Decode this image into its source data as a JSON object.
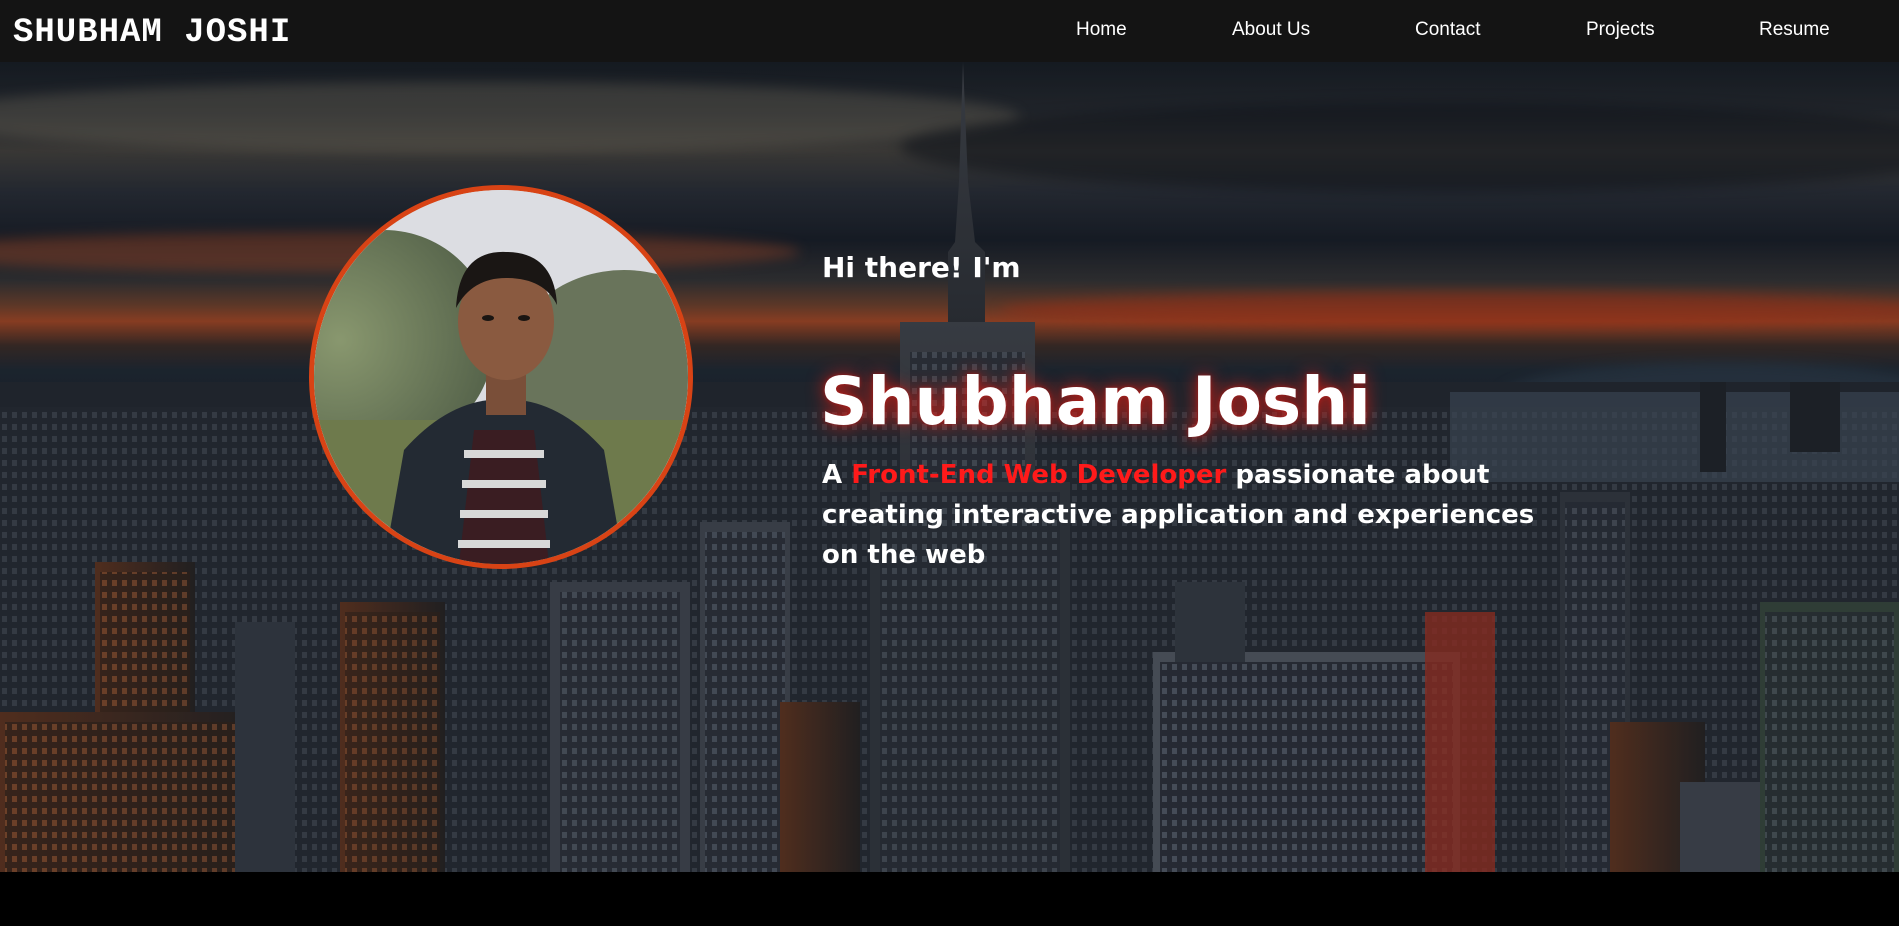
{
  "brand": {
    "name": "SHUBHAM JOSHI"
  },
  "nav": {
    "items": [
      {
        "label": "Home"
      },
      {
        "label": "About Us"
      },
      {
        "label": "Contact"
      },
      {
        "label": "Projects"
      },
      {
        "label": "Resume"
      }
    ]
  },
  "hero": {
    "intro": "Hi there! I'm",
    "name": "Shubham Joshi",
    "tagline_prefix": "A ",
    "tagline_highlight": "Front-End Web Developer",
    "tagline_suffix": " passionate about creating interactive application and experiences on the web"
  },
  "colors": {
    "accent": "#ff1a1a",
    "avatar_border": "#d84315",
    "navbar_bg": "#141414",
    "text": "#ffffff"
  }
}
